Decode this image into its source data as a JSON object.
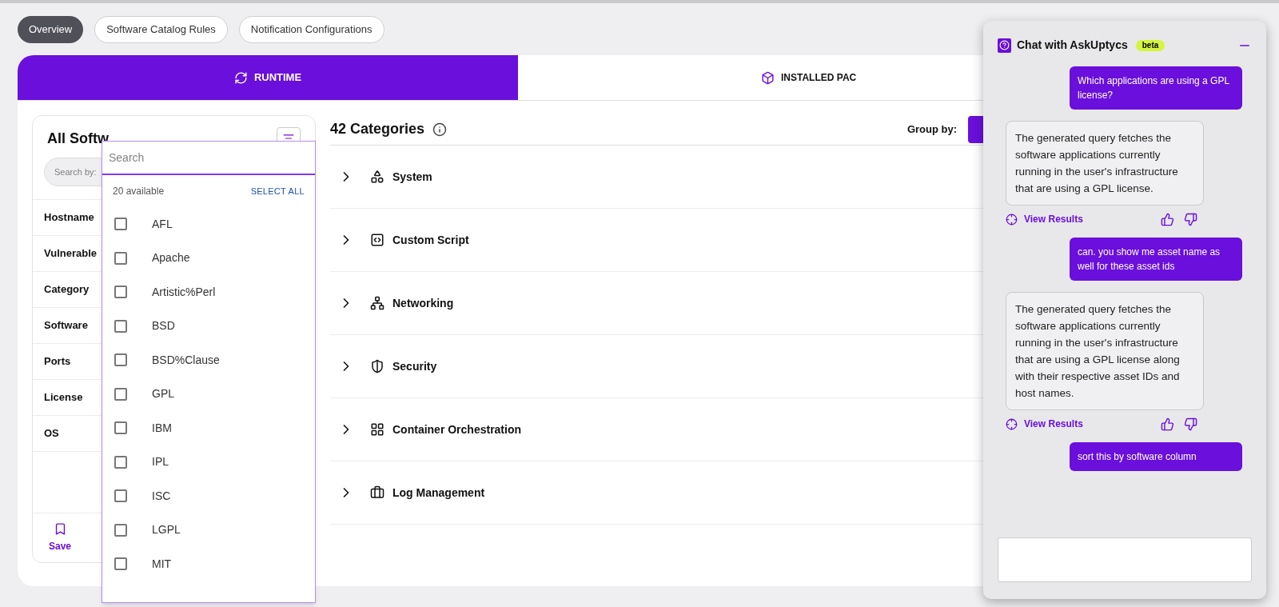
{
  "top_tabs": [
    {
      "label": "Overview",
      "selected": true
    },
    {
      "label": "Software Catalog Rules",
      "selected": false
    },
    {
      "label": "Notification Configurations",
      "selected": false
    }
  ],
  "view_tabs": [
    {
      "label": "RUNTIME",
      "selected": true
    },
    {
      "label": "INSTALLED PAC",
      "selected": false
    }
  ],
  "sidebar": {
    "title": "All Softw",
    "search_placeholder": "Search by:",
    "items": [
      "Hostname",
      "Vulnerable",
      "Category",
      "Software",
      "Ports",
      "License",
      "OS"
    ],
    "save_label": "Save"
  },
  "dropdown": {
    "placeholder": "Search",
    "count": "20 available",
    "select_all": "SELECT ALL",
    "options": [
      {
        "label": "AFL",
        "checked": false
      },
      {
        "label": "Apache",
        "checked": false
      },
      {
        "label": "Artistic%Perl",
        "checked": false
      },
      {
        "label": "BSD",
        "checked": false
      },
      {
        "label": "BSD%Clause",
        "checked": false
      },
      {
        "label": "GPL",
        "checked": false
      },
      {
        "label": "IBM",
        "checked": false
      },
      {
        "label": "IPL",
        "checked": false
      },
      {
        "label": "ISC",
        "checked": false
      },
      {
        "label": "LGPL",
        "checked": false
      },
      {
        "label": "MIT",
        "checked": false
      }
    ]
  },
  "categories": {
    "title": "42 Categories",
    "group_by": "Group by:",
    "rows": [
      "System",
      "Custom Script",
      "Networking",
      "Security",
      "Container Orchestration",
      "Log Management"
    ]
  },
  "chat": {
    "title": "Chat with AskUptycs",
    "badge": "beta",
    "messages": [
      {
        "kind": "user",
        "text": "Which applications are using a GPL license?"
      },
      {
        "kind": "bot",
        "text": "The generated query fetches the software applications currently running in the user's infrastructure that are using a GPL license.",
        "action": "View Results"
      },
      {
        "kind": "user",
        "text": "can. you show me asset name as well for these asset ids"
      },
      {
        "kind": "bot",
        "text": "The generated query fetches the software applications currently running in the user's infrastructure that are using a GPL license along with their respective asset IDs and host names.",
        "action": "View Results"
      },
      {
        "kind": "user",
        "text": "sort this by software column"
      }
    ]
  }
}
